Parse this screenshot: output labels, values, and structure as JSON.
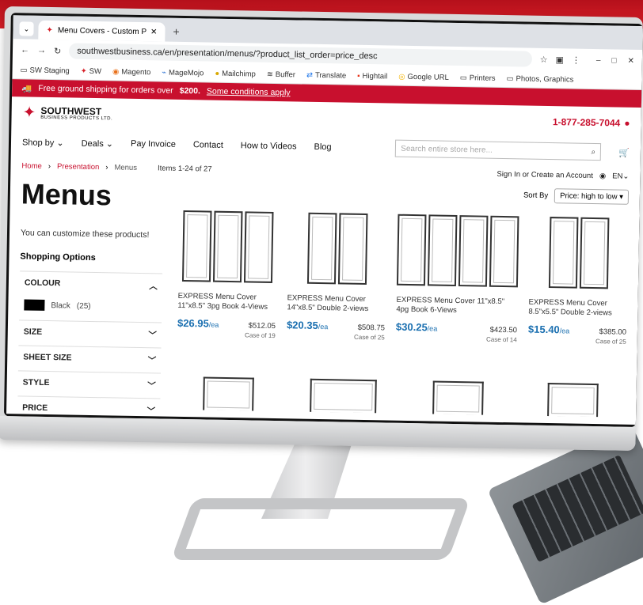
{
  "browser": {
    "tab_title": "Menu Covers - Custom Presen...",
    "new_tab": "+",
    "url": "southwestbusiness.ca/en/presentation/menus/?product_list_order=price_desc",
    "bookmarks": [
      "SW Staging",
      "SW",
      "Magento",
      "MageMojo",
      "Mailchimp",
      "Buffer",
      "Translate",
      "Hightail",
      "Google URL",
      "Printers",
      "Photos, Graphics"
    ]
  },
  "banner": {
    "text_prefix": "Free ground shipping for orders over",
    "amount": "$200.",
    "link": "Some conditions apply"
  },
  "header": {
    "logo_line1": "SOUTHWEST",
    "logo_line2": "BUSINESS PRODUCTS LTD.",
    "phone": "1-877-285-7044"
  },
  "nav": {
    "items": [
      "Shop by",
      "Deals",
      "Pay Invoice",
      "Contact",
      "How to Videos",
      "Blog"
    ],
    "search_placeholder": "Search entire store here..."
  },
  "breadcrumb": {
    "home": "Home",
    "presentation": "Presentation",
    "current": "Menus",
    "items_count": "Items 1-24 of 27"
  },
  "account": {
    "signin": "Sign In or Create an Account",
    "lang": "EN"
  },
  "page": {
    "title": "Menus",
    "note": "You can customize these products!",
    "shopping_options": "Shopping Options",
    "colour_label": "COLOUR",
    "colour_value": "Black",
    "colour_count": "(25)",
    "filters": [
      "SIZE",
      "SHEET SIZE",
      "STYLE",
      "PRICE"
    ],
    "sort_label": "Sort By",
    "sort_value": "Price: high to low"
  },
  "products": [
    {
      "name": "EXPRESS Menu Cover 11\"x8.5\" 3pg Book 4-Views",
      "price": "$26.95",
      "unit": "/ea",
      "case_price": "$512.05",
      "case": "Case of 19",
      "panels": 3
    },
    {
      "name": "EXPRESS Menu Cover 14\"x8.5\" Double 2-views",
      "price": "$20.35",
      "unit": "/ea",
      "case_price": "$508.75",
      "case": "Case of 25",
      "panels": 2
    },
    {
      "name": "EXPRESS Menu Cover 11\"x8.5\" 4pg Book 6-Views",
      "price": "$30.25",
      "unit": "/ea",
      "case_price": "$423.50",
      "case": "Case of 14",
      "panels": 4
    },
    {
      "name": "EXPRESS Menu Cover 8.5\"x5.5\" Double 2-views",
      "price": "$15.40",
      "unit": "/ea",
      "case_price": "$385.00",
      "case": "Case of 25",
      "panels": 2
    }
  ]
}
